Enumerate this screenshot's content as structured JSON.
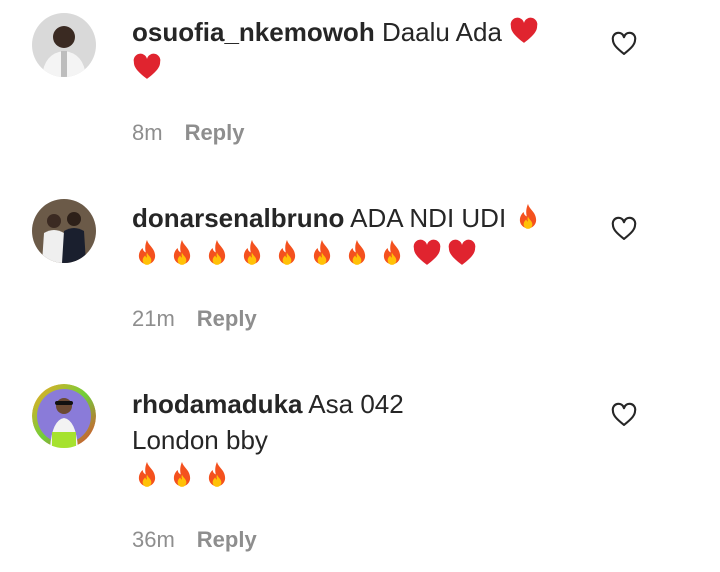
{
  "comments": [
    {
      "username": "osuofia_nkemowoh",
      "text": "Daalu Ada",
      "lines": [],
      "time": "8m",
      "reply_label": "Reply",
      "avatar_icon": "avatar-man-in-white",
      "emojis_inline": [
        "heart"
      ],
      "emojis_line": [
        "heart"
      ]
    },
    {
      "username": "donarsenalbruno",
      "text": "ADA NDI UDI",
      "lines": [],
      "time": "21m",
      "reply_label": "Reply",
      "avatar_icon": "avatar-two-men",
      "emojis_inline": [
        "fire"
      ],
      "emojis_line": [
        "fire",
        "fire",
        "fire",
        "fire",
        "fire",
        "fire",
        "fire",
        "fire",
        "heart",
        "heart"
      ]
    },
    {
      "username": "rhodamaduka",
      "text": "Asa 042",
      "lines": [
        "London bby"
      ],
      "time": "36m",
      "reply_label": "Reply",
      "avatar_icon": "avatar-woman-story-ring",
      "emojis_inline": [],
      "emojis_line": [
        "fire",
        "fire",
        "fire"
      ]
    }
  ],
  "colors": {
    "heart": "#e0242f",
    "fire_outer": "#f4511e",
    "fire_inner": "#ffc107",
    "muted": "#8e8e8e",
    "text": "#262626"
  }
}
